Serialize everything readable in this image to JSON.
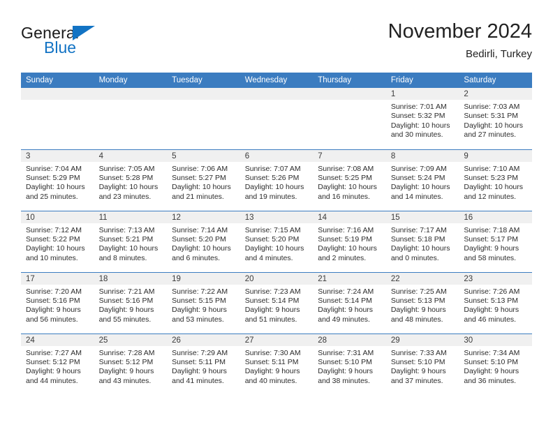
{
  "brand": {
    "name_part1": "General",
    "name_part2": "Blue",
    "logo_icon": "triangle-logo-icon",
    "accent_color": "#1273c4"
  },
  "header": {
    "title": "November 2024",
    "subtitle": "Bedirli, Turkey"
  },
  "theme": {
    "header_bg": "#3b7cc0",
    "daynum_band_bg": "#f0f0f0",
    "grid_line": "#3b7cc0",
    "text": "#2b2b2b"
  },
  "weekday_headers": [
    "Sunday",
    "Monday",
    "Tuesday",
    "Wednesday",
    "Thursday",
    "Friday",
    "Saturday"
  ],
  "weeks": [
    [
      {
        "day": "",
        "empty": true
      },
      {
        "day": "",
        "empty": true
      },
      {
        "day": "",
        "empty": true
      },
      {
        "day": "",
        "empty": true
      },
      {
        "day": "",
        "empty": true
      },
      {
        "day": "1",
        "sunrise": "Sunrise: 7:01 AM",
        "sunset": "Sunset: 5:32 PM",
        "daylight_line1": "Daylight: 10 hours",
        "daylight_line2": "and 30 minutes."
      },
      {
        "day": "2",
        "sunrise": "Sunrise: 7:03 AM",
        "sunset": "Sunset: 5:31 PM",
        "daylight_line1": "Daylight: 10 hours",
        "daylight_line2": "and 27 minutes."
      }
    ],
    [
      {
        "day": "3",
        "sunrise": "Sunrise: 7:04 AM",
        "sunset": "Sunset: 5:29 PM",
        "daylight_line1": "Daylight: 10 hours",
        "daylight_line2": "and 25 minutes."
      },
      {
        "day": "4",
        "sunrise": "Sunrise: 7:05 AM",
        "sunset": "Sunset: 5:28 PM",
        "daylight_line1": "Daylight: 10 hours",
        "daylight_line2": "and 23 minutes."
      },
      {
        "day": "5",
        "sunrise": "Sunrise: 7:06 AM",
        "sunset": "Sunset: 5:27 PM",
        "daylight_line1": "Daylight: 10 hours",
        "daylight_line2": "and 21 minutes."
      },
      {
        "day": "6",
        "sunrise": "Sunrise: 7:07 AM",
        "sunset": "Sunset: 5:26 PM",
        "daylight_line1": "Daylight: 10 hours",
        "daylight_line2": "and 19 minutes."
      },
      {
        "day": "7",
        "sunrise": "Sunrise: 7:08 AM",
        "sunset": "Sunset: 5:25 PM",
        "daylight_line1": "Daylight: 10 hours",
        "daylight_line2": "and 16 minutes."
      },
      {
        "day": "8",
        "sunrise": "Sunrise: 7:09 AM",
        "sunset": "Sunset: 5:24 PM",
        "daylight_line1": "Daylight: 10 hours",
        "daylight_line2": "and 14 minutes."
      },
      {
        "day": "9",
        "sunrise": "Sunrise: 7:10 AM",
        "sunset": "Sunset: 5:23 PM",
        "daylight_line1": "Daylight: 10 hours",
        "daylight_line2": "and 12 minutes."
      }
    ],
    [
      {
        "day": "10",
        "sunrise": "Sunrise: 7:12 AM",
        "sunset": "Sunset: 5:22 PM",
        "daylight_line1": "Daylight: 10 hours",
        "daylight_line2": "and 10 minutes."
      },
      {
        "day": "11",
        "sunrise": "Sunrise: 7:13 AM",
        "sunset": "Sunset: 5:21 PM",
        "daylight_line1": "Daylight: 10 hours",
        "daylight_line2": "and 8 minutes."
      },
      {
        "day": "12",
        "sunrise": "Sunrise: 7:14 AM",
        "sunset": "Sunset: 5:20 PM",
        "daylight_line1": "Daylight: 10 hours",
        "daylight_line2": "and 6 minutes."
      },
      {
        "day": "13",
        "sunrise": "Sunrise: 7:15 AM",
        "sunset": "Sunset: 5:20 PM",
        "daylight_line1": "Daylight: 10 hours",
        "daylight_line2": "and 4 minutes."
      },
      {
        "day": "14",
        "sunrise": "Sunrise: 7:16 AM",
        "sunset": "Sunset: 5:19 PM",
        "daylight_line1": "Daylight: 10 hours",
        "daylight_line2": "and 2 minutes."
      },
      {
        "day": "15",
        "sunrise": "Sunrise: 7:17 AM",
        "sunset": "Sunset: 5:18 PM",
        "daylight_line1": "Daylight: 10 hours",
        "daylight_line2": "and 0 minutes."
      },
      {
        "day": "16",
        "sunrise": "Sunrise: 7:18 AM",
        "sunset": "Sunset: 5:17 PM",
        "daylight_line1": "Daylight: 9 hours",
        "daylight_line2": "and 58 minutes."
      }
    ],
    [
      {
        "day": "17",
        "sunrise": "Sunrise: 7:20 AM",
        "sunset": "Sunset: 5:16 PM",
        "daylight_line1": "Daylight: 9 hours",
        "daylight_line2": "and 56 minutes."
      },
      {
        "day": "18",
        "sunrise": "Sunrise: 7:21 AM",
        "sunset": "Sunset: 5:16 PM",
        "daylight_line1": "Daylight: 9 hours",
        "daylight_line2": "and 55 minutes."
      },
      {
        "day": "19",
        "sunrise": "Sunrise: 7:22 AM",
        "sunset": "Sunset: 5:15 PM",
        "daylight_line1": "Daylight: 9 hours",
        "daylight_line2": "and 53 minutes."
      },
      {
        "day": "20",
        "sunrise": "Sunrise: 7:23 AM",
        "sunset": "Sunset: 5:14 PM",
        "daylight_line1": "Daylight: 9 hours",
        "daylight_line2": "and 51 minutes."
      },
      {
        "day": "21",
        "sunrise": "Sunrise: 7:24 AM",
        "sunset": "Sunset: 5:14 PM",
        "daylight_line1": "Daylight: 9 hours",
        "daylight_line2": "and 49 minutes."
      },
      {
        "day": "22",
        "sunrise": "Sunrise: 7:25 AM",
        "sunset": "Sunset: 5:13 PM",
        "daylight_line1": "Daylight: 9 hours",
        "daylight_line2": "and 48 minutes."
      },
      {
        "day": "23",
        "sunrise": "Sunrise: 7:26 AM",
        "sunset": "Sunset: 5:13 PM",
        "daylight_line1": "Daylight: 9 hours",
        "daylight_line2": "and 46 minutes."
      }
    ],
    [
      {
        "day": "24",
        "sunrise": "Sunrise: 7:27 AM",
        "sunset": "Sunset: 5:12 PM",
        "daylight_line1": "Daylight: 9 hours",
        "daylight_line2": "and 44 minutes."
      },
      {
        "day": "25",
        "sunrise": "Sunrise: 7:28 AM",
        "sunset": "Sunset: 5:12 PM",
        "daylight_line1": "Daylight: 9 hours",
        "daylight_line2": "and 43 minutes."
      },
      {
        "day": "26",
        "sunrise": "Sunrise: 7:29 AM",
        "sunset": "Sunset: 5:11 PM",
        "daylight_line1": "Daylight: 9 hours",
        "daylight_line2": "and 41 minutes."
      },
      {
        "day": "27",
        "sunrise": "Sunrise: 7:30 AM",
        "sunset": "Sunset: 5:11 PM",
        "daylight_line1": "Daylight: 9 hours",
        "daylight_line2": "and 40 minutes."
      },
      {
        "day": "28",
        "sunrise": "Sunrise: 7:31 AM",
        "sunset": "Sunset: 5:10 PM",
        "daylight_line1": "Daylight: 9 hours",
        "daylight_line2": "and 38 minutes."
      },
      {
        "day": "29",
        "sunrise": "Sunrise: 7:33 AM",
        "sunset": "Sunset: 5:10 PM",
        "daylight_line1": "Daylight: 9 hours",
        "daylight_line2": "and 37 minutes."
      },
      {
        "day": "30",
        "sunrise": "Sunrise: 7:34 AM",
        "sunset": "Sunset: 5:10 PM",
        "daylight_line1": "Daylight: 9 hours",
        "daylight_line2": "and 36 minutes."
      }
    ]
  ]
}
